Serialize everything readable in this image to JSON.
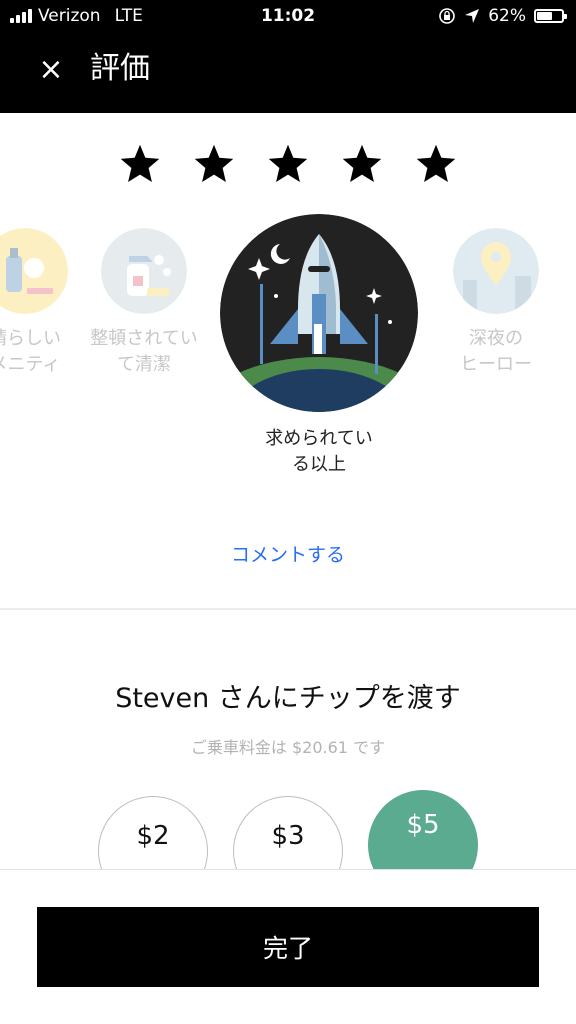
{
  "status_bar": {
    "carrier": "Verizon",
    "network": "LTE",
    "time": "11:02",
    "battery": "62%",
    "battery_level": 0.62
  },
  "header": {
    "close_icon": "×",
    "title": "評価"
  },
  "rating": {
    "value": 5,
    "max": 5,
    "star_color": "#000000"
  },
  "compliments": [
    {
      "label_line1": "晴らしい",
      "label_line2": "メニティ",
      "icon": "amenities-icon",
      "color": "#f9dc7a"
    },
    {
      "label_line1": "整頓されてい",
      "label_line2": "て清潔",
      "icon": "clean-spray-icon",
      "color": "#c9d5da"
    },
    {
      "label_line1": "求められてい",
      "label_line2": "る以上",
      "icon": "rocket-icon",
      "color": "#222222"
    },
    {
      "label_line1": "深夜の",
      "label_line2": "ヒーロー",
      "icon": "night-hero-icon",
      "color": "#b9d3e0"
    }
  ],
  "comment_link": "コメントする",
  "tip": {
    "title": "Steven さんにチップを渡す",
    "subtitle": "ご乗車料金は $20.61 です",
    "options": [
      "$2",
      "$3",
      "$5"
    ],
    "selected": "$5",
    "accent": "#5aab8f"
  },
  "done_button": "完了"
}
